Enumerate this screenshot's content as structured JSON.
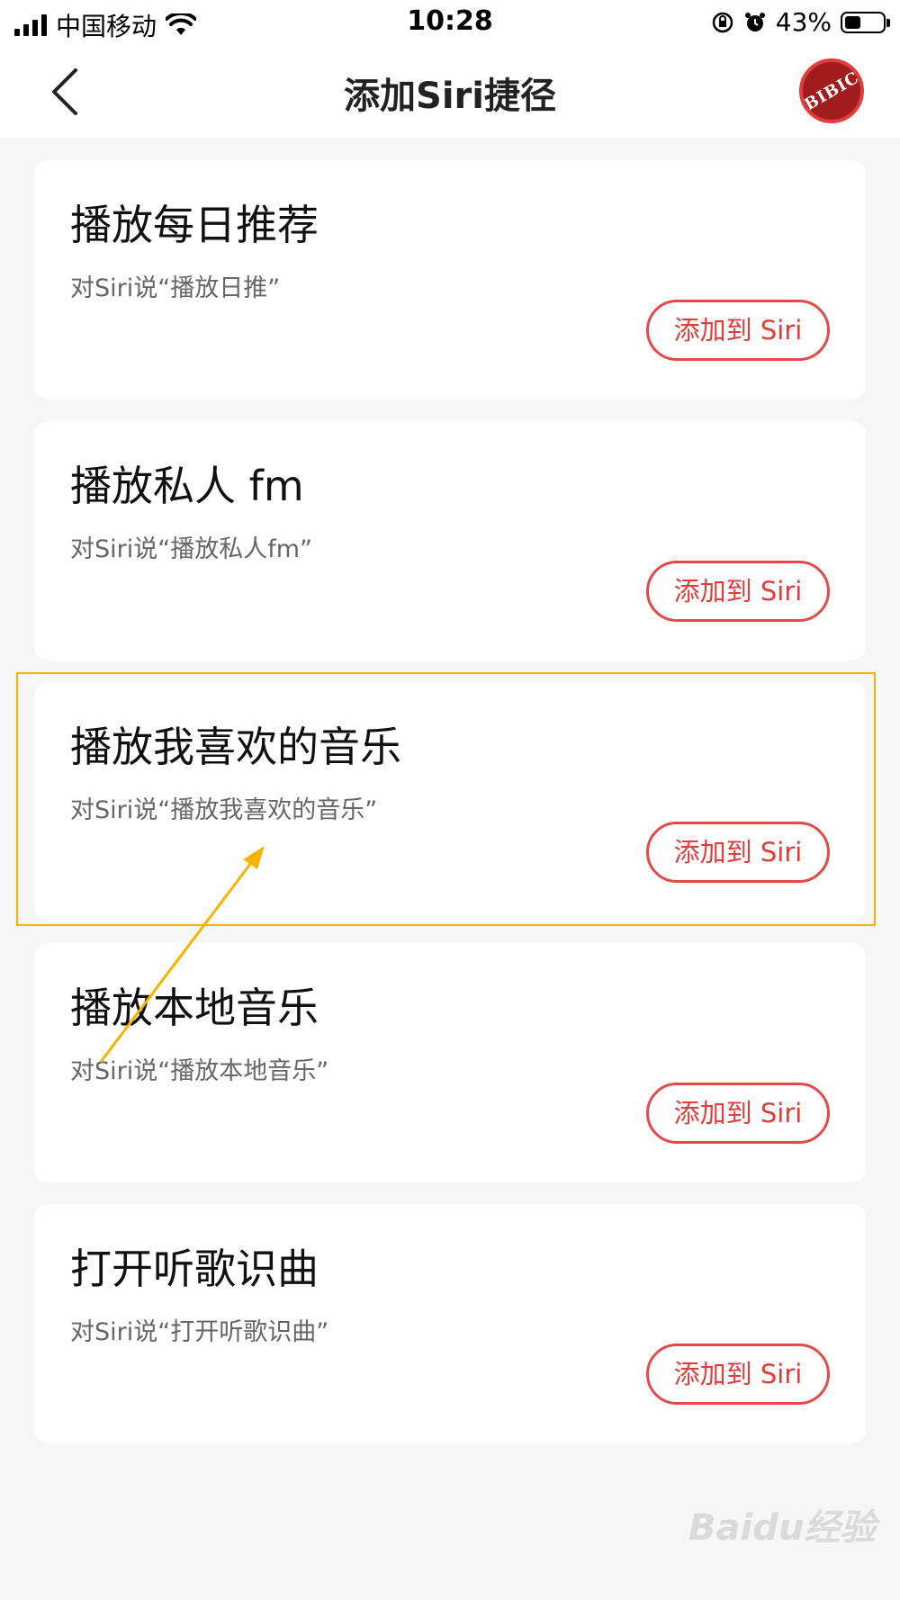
{
  "status_bar": {
    "carrier": "中国移动",
    "time": "10:28",
    "battery": "43%",
    "battery_level": 0.43
  },
  "nav": {
    "title": "添加Siri捷径",
    "avatar_text": "BIBIC"
  },
  "shortcuts": [
    {
      "title": "播放每日推荐",
      "subtitle": "对Siri说“播放日推”",
      "button": "添加到 Siri"
    },
    {
      "title": "播放私人 fm",
      "subtitle": "对Siri说“播放私人fm”",
      "button": "添加到 Siri"
    },
    {
      "title": "播放我喜欢的音乐",
      "subtitle": "对Siri说“播放我喜欢的音乐”",
      "button": "添加到 Siri"
    },
    {
      "title": "播放本地音乐",
      "subtitle": "对Siri说“播放本地音乐”",
      "button": "添加到 Siri"
    },
    {
      "title": "打开听歌识曲",
      "subtitle": "对Siri说“打开听歌识曲”",
      "button": "添加到 Siri"
    }
  ],
  "watermark": "Baidu经验",
  "colors": {
    "accent": "#e43b3b",
    "highlight": "#f6b400",
    "background": "#f6f6f6"
  }
}
